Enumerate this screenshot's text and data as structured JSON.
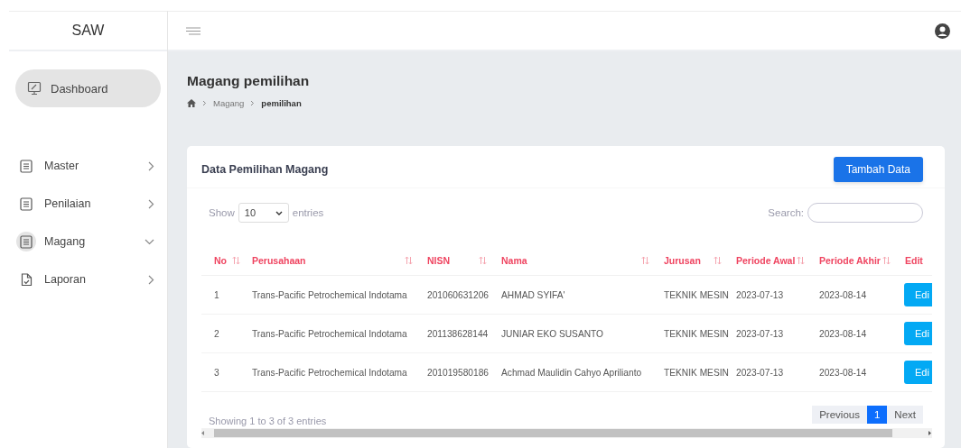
{
  "app_name": "SAW",
  "sidebar": {
    "items": [
      {
        "label": "Dashboard",
        "kind": "link",
        "selected": true
      },
      {
        "label": "Master",
        "kind": "group",
        "selected": false,
        "expanded": false
      },
      {
        "label": "Penilaian",
        "kind": "group",
        "selected": false,
        "expanded": false
      },
      {
        "label": "Magang",
        "kind": "group",
        "selected": true,
        "expanded": true
      },
      {
        "label": "Laporan",
        "kind": "report",
        "selected": false,
        "expanded": false
      }
    ]
  },
  "page": {
    "title": "Magang pemilihan",
    "breadcrumb": [
      "Magang",
      "pemilihan"
    ]
  },
  "card": {
    "title": "Data Pemilihan Magang",
    "add_button": "Tambah Data",
    "show_label": "Show",
    "page_size": "10",
    "entries_label": "entries",
    "search_label": "Search:",
    "table": {
      "columns": [
        {
          "label": "No",
          "sortable": true
        },
        {
          "label": "Perusahaan",
          "sortable": true
        },
        {
          "label": "NISN",
          "sortable": true
        },
        {
          "label": "Nama",
          "sortable": true
        },
        {
          "label": "Jurusan",
          "sortable": true
        },
        {
          "label": "Periode Awal",
          "sortable": true
        },
        {
          "label": "Periode Akhir",
          "sortable": true
        },
        {
          "label": "Edit"
        }
      ],
      "rows": [
        {
          "cells": [
            "1",
            "Trans-Pacific Petrochemical Indotama",
            "201060631206",
            "AHMAD SYIFA'",
            "TEKNIK MESIN",
            "2023-07-13",
            "2023-08-14"
          ],
          "action": "Edi"
        },
        {
          "cells": [
            "2",
            "Trans-Pacific Petrochemical Indotama",
            "201138628144",
            "JUNIAR EKO SUSANTO",
            "TEKNIK MESIN",
            "2023-07-13",
            "2023-08-14"
          ],
          "action": "Edi"
        },
        {
          "cells": [
            "3",
            "Trans-Pacific Petrochemical Indotama",
            "201019580186",
            "Achmad Maulidin Cahyo Aprilianto",
            "TEKNIK MESIN",
            "2023-07-13",
            "2023-08-14"
          ],
          "action": "Edi"
        }
      ]
    },
    "info": "Showing 1 to 3 of 3 entries",
    "pagination": [
      {
        "label": "Previous",
        "selected": false
      },
      {
        "label": "1",
        "selected": true
      },
      {
        "label": "Next",
        "selected": false
      }
    ]
  }
}
